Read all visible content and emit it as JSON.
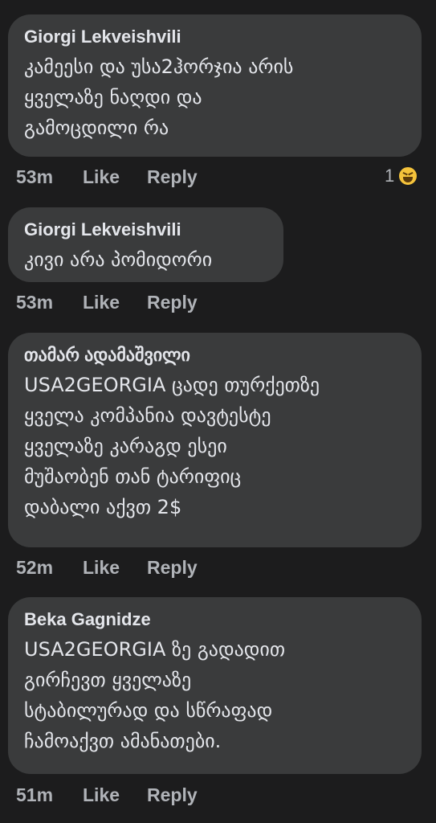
{
  "comments": [
    {
      "author": "Giorgi Lekveishvili",
      "text": "კამეესი და უსა2ჰორჯია არის\nყველაზე ნაღდი და\nგამოცდილი რა",
      "time": "53m",
      "like": "Like",
      "reply": "Reply",
      "reaction_count": "1",
      "reaction_icon": "laughing-emoji-icon"
    },
    {
      "author": "Giorgi Lekveishvili",
      "text": "კივი არა პომიდორი",
      "time": "53m",
      "like": "Like",
      "reply": "Reply"
    },
    {
      "author": "თამარ ადამაშვილი",
      "text": "USA2GEORGIA ცადე თურქეთზე\nყველა კომპანია დავტესტე\nყველაზე კარაგდ ესეი\nმუშაობენ თან ტარიფიც\nდაბალი აქვთ 2$",
      "time": "52m",
      "like": "Like",
      "reply": "Reply"
    },
    {
      "author": "Beka Gagnidze",
      "text": "USA2GEORGIA ზე გადადით\nგირჩევთ ყველაზე\nსტაბილურად და სწრაფად\nჩამოაქვთ ამანათები.",
      "time": "51m",
      "like": "Like",
      "reply": "Reply"
    }
  ],
  "colors": {
    "background": "#1c1c1d",
    "bubble": "#3a3b3c",
    "text": "#e4e6eb",
    "meta": "#b0b3b8"
  }
}
